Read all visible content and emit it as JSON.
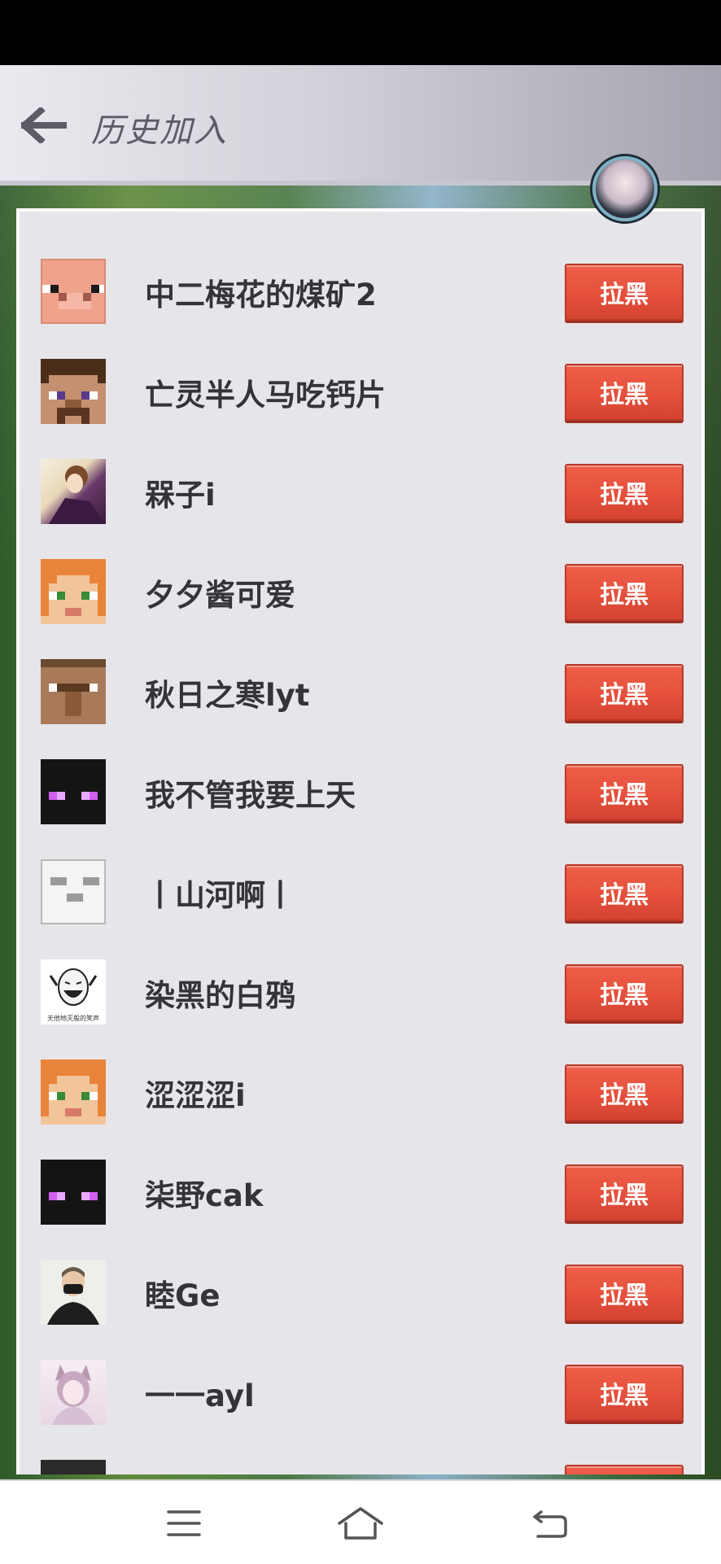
{
  "header": {
    "title": "历史加入"
  },
  "colors": {
    "block_button": "#e4503c",
    "panel_bg": "#e6e6ea",
    "name_text": "#333338"
  },
  "players": [
    {
      "name": "中二梅花的煤矿2",
      "avatar": "pig-face-icon",
      "action": "拉黑"
    },
    {
      "name": "亡灵半人马吃钙片",
      "avatar": "steve-face-icon",
      "action": "拉黑"
    },
    {
      "name": "槑子i",
      "avatar": "anime-portrait-avatar",
      "action": "拉黑"
    },
    {
      "name": "夕夕酱可爱",
      "avatar": "alex-face-icon",
      "action": "拉黑"
    },
    {
      "name": "秋日之寒lyt",
      "avatar": "villager-face-icon",
      "action": "拉黑"
    },
    {
      "name": "我不管我要上天",
      "avatar": "enderman-face-icon",
      "action": "拉黑"
    },
    {
      "name": "丨山河啊丨",
      "avatar": "ghast-face-icon",
      "action": "拉黑"
    },
    {
      "name": "染黑的白鸦",
      "avatar": "meme-face-avatar",
      "action": "拉黑"
    },
    {
      "name": "涩涩涩i",
      "avatar": "alex-face-icon",
      "action": "拉黑"
    },
    {
      "name": "柒野cak",
      "avatar": "enderman-face-icon",
      "action": "拉黑"
    },
    {
      "name": "睦Ge",
      "avatar": "masked-man-avatar",
      "action": "拉黑"
    },
    {
      "name": "一一ayl",
      "avatar": "anime-girl-avatar",
      "action": "拉黑"
    },
    {
      "name": "",
      "avatar": "partial-avatar",
      "action": ""
    }
  ],
  "avatar_caption": "天他地灭般的笑声",
  "navigation": {
    "menu": "menu-icon",
    "home": "home-icon",
    "back": "back-icon"
  }
}
